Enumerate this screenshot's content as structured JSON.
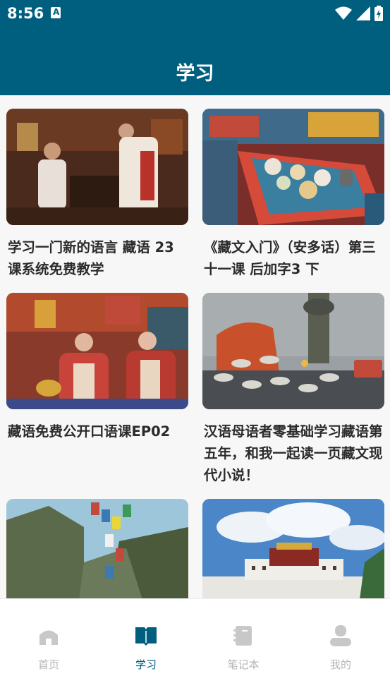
{
  "status_bar": {
    "time": "8:56",
    "icons": [
      "notification-icon",
      "wifi-icon",
      "signal-icon",
      "battery-icon"
    ]
  },
  "app_bar": {
    "title": "学习"
  },
  "colors": {
    "primary": "#005f7f",
    "nav_inactive": "#b5b5b5",
    "text": "#2b2b2b",
    "background": "#f7f7f7"
  },
  "cards": [
    {
      "title": "学习一门新的语言 藏语 23课系统免费教学",
      "image": "couple-in-tibetan-house-photo"
    },
    {
      "title": "《藏文入门》（安多话）第三十一课 后加字3 下",
      "image": "tibetan-table-meal-photo"
    },
    {
      "title": "藏语免费公开口语课EP02",
      "image": "women-serving-tea-photo"
    },
    {
      "title": "汉语母语者零基础学习藏语第五年，和我一起读一页藏文现代小说！",
      "image": "butter-lamps-photo"
    },
    {
      "title": "",
      "image": "prayer-flags-mountain-photo"
    },
    {
      "title": "",
      "image": "potala-palace-photo"
    }
  ],
  "nav": [
    {
      "label": "首页",
      "icon": "home-icon",
      "active": false
    },
    {
      "label": "学习",
      "icon": "book-icon",
      "active": true
    },
    {
      "label": "笔记本",
      "icon": "notebook-icon",
      "active": false
    },
    {
      "label": "我的",
      "icon": "person-icon",
      "active": false
    }
  ]
}
